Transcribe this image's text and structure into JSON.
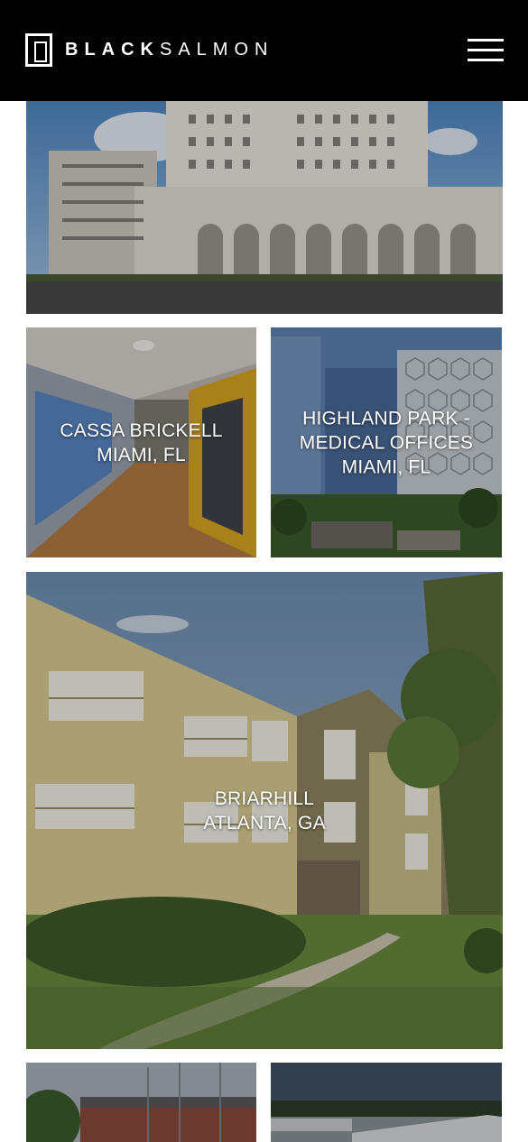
{
  "header": {
    "logo_black": "BLACK",
    "logo_salmon": "SALMON",
    "menu_icon": "hamburger-menu-icon"
  },
  "properties": [
    {
      "id": "top",
      "title": "",
      "location": ""
    },
    {
      "id": "cassa",
      "title": "CASSA BRICKELL",
      "location": "MIAMI, FL"
    },
    {
      "id": "highland",
      "title_line1": "HIGHLAND PARK -",
      "title_line2": "MEDICAL OFFICES",
      "location": "MIAMI, FL"
    },
    {
      "id": "briarhill",
      "title": "BRIARHILL",
      "location": "ATLANTA, GA"
    },
    {
      "id": "bottom-left",
      "title": "",
      "location": ""
    },
    {
      "id": "bottom-right",
      "title": "",
      "location": ""
    }
  ],
  "colors": {
    "header_bg": "#000000",
    "text": "#ffffff"
  }
}
